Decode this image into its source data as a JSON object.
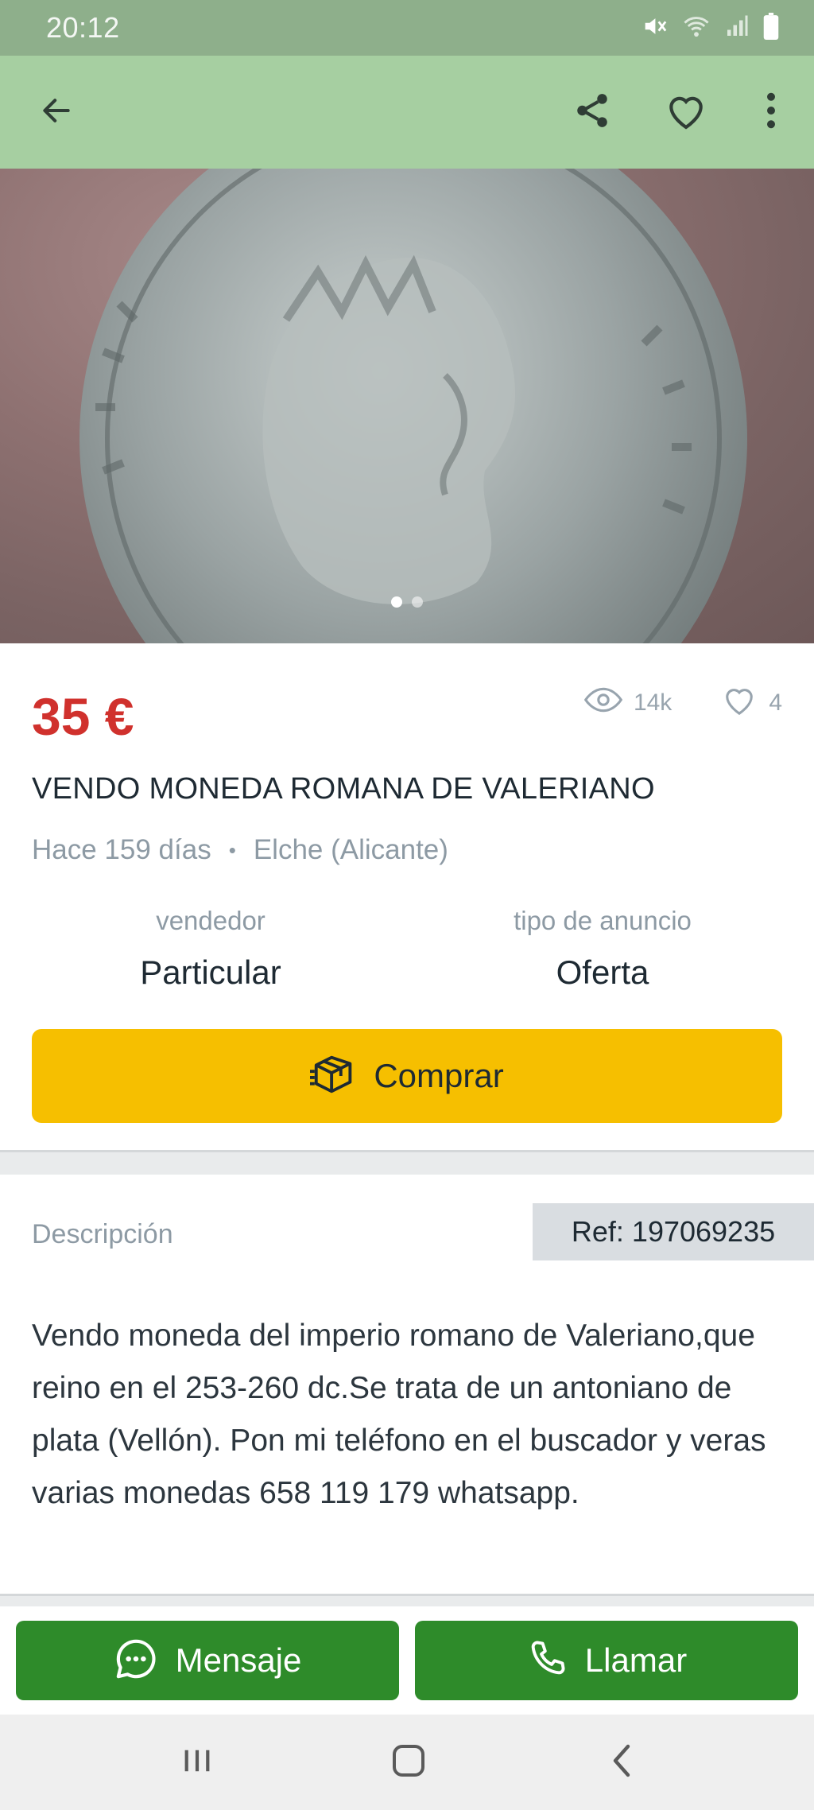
{
  "status_bar": {
    "time": "20:12",
    "icons": [
      "mute-icon",
      "wifi-icon",
      "signal-icon",
      "battery-icon"
    ]
  },
  "app_bar": {
    "icons": [
      "back-arrow-icon",
      "share-icon",
      "heart-icon",
      "more-vert-icon"
    ]
  },
  "gallery": {
    "image": "roman-coin-photo",
    "page_count": 2,
    "active_index": 0
  },
  "listing": {
    "price": "35 €",
    "views": "14k",
    "likes": "4",
    "title": "VENDO MONEDA ROMANA DE VALERIANO",
    "posted": "Hace 159 días",
    "separator": "•",
    "location": "Elche (Alicante)",
    "seller_label": "vendedor",
    "seller_value": "Particular",
    "ad_type_label": "tipo de anuncio",
    "ad_type_value": "Oferta",
    "buy_label": "Comprar"
  },
  "description": {
    "heading": "Descripción",
    "ref": "Ref: 197069235",
    "text": "Vendo moneda del imperio romano de Valeriano,que reino en el 253-260 dc.Se trata de un antoniano de plata (Vellón). Pon mi teléfono en el buscador y veras varias monedas 658 119 179 whatsapp."
  },
  "actions": {
    "message_label": "Mensaje",
    "call_label": "Llamar"
  },
  "colors": {
    "accent_green": "#2e8b2a",
    "appbar": "#a6cfa1",
    "price_red": "#d0312d",
    "buy_yellow": "#f6bf00"
  }
}
